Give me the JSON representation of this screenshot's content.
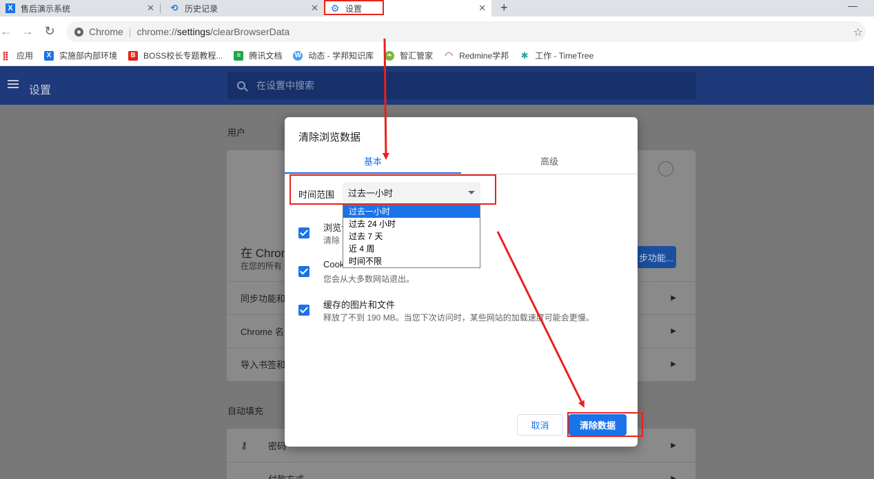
{
  "tabs": [
    {
      "label": "售后演示系统",
      "icon": "x-logo-icon"
    },
    {
      "label": "历史记录",
      "icon": "history-icon"
    },
    {
      "label": "设置",
      "icon": "gear-icon"
    }
  ],
  "omnibox": {
    "origin": "Chrome",
    "url_scheme": "chrome://",
    "url_host": "settings",
    "url_path": "/clearBrowserData"
  },
  "bookmarks": [
    {
      "label": "应用",
      "icon": "apps-grid-icon"
    },
    {
      "label": "实施部内部环境",
      "icon": "x-logo-icon"
    },
    {
      "label": "BOSS校长专题教程...",
      "icon": "boss-logo-icon"
    },
    {
      "label": "腾讯文档",
      "icon": "doc-icon"
    },
    {
      "label": "动态 - 学邦知识库",
      "icon": "wiki-icon"
    },
    {
      "label": "智汇管家",
      "icon": "leaf-icon"
    },
    {
      "label": "Redmine学邦",
      "icon": "redmine-icon"
    },
    {
      "label": "工作 - TimeTree",
      "icon": "timetree-icon"
    }
  ],
  "settings": {
    "title": "设置",
    "search_placeholder": "在设置中搜索",
    "section_users": "用户",
    "section_autofill": "自动填充",
    "card_heading_fragment": "在 Chrom",
    "card_sub_fragment": "在您的所有",
    "sync_button_fragment": "步功能...",
    "rows": [
      "同步功能和",
      "Chrome 名",
      "导入书签和"
    ],
    "autofill_rows": [
      "密码",
      "付款方式"
    ]
  },
  "dialog": {
    "title": "清除浏览数据",
    "tab_basic": "基本",
    "tab_advanced": "高级",
    "time_range_label": "时间范围",
    "time_range_value": "过去一小时",
    "time_range_options": [
      "过去一小时",
      "过去 24 小时",
      "过去 7 天",
      "近 4 周",
      "时间不限"
    ],
    "items": [
      {
        "title": "浏览记",
        "subtitle": "清除"
      },
      {
        "title": "Cook",
        "subtitle": "您会从大多数网站退出。"
      },
      {
        "title": "缓存的图片和文件",
        "subtitle": "释放了不到 190 MB。当您下次访问时，某些网站的加载速度可能会更慢。"
      }
    ],
    "cancel_label": "取消",
    "clear_label": "清除数据"
  },
  "colors": {
    "accent": "#1a73e8",
    "header": "#1f3a7a",
    "annotation": "#e8221b"
  }
}
